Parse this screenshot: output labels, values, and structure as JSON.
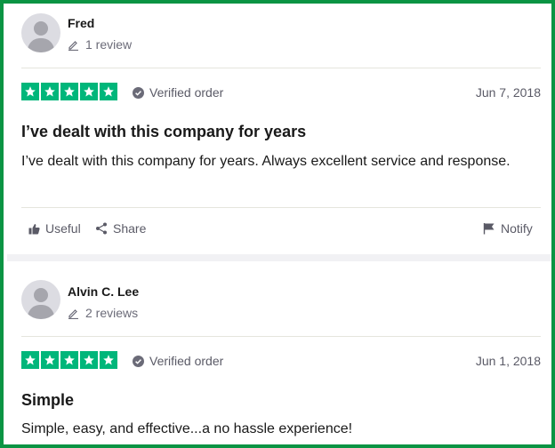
{
  "reviews": [
    {
      "author": "Fred",
      "review_count": "1 review",
      "rating": 5,
      "verified_label": "Verified order",
      "date": "Jun 7, 2018",
      "title": "I’ve dealt with this company for years",
      "body": "I’ve dealt with this company for years. Always excellent service and response."
    },
    {
      "author": "Alvin C. Lee",
      "review_count": "2 reviews",
      "rating": 5,
      "verified_label": "Verified order",
      "date": "Jun 1, 2018",
      "title": "Simple",
      "body": "Simple, easy, and effective...a no hassle experience!"
    }
  ],
  "actions": {
    "useful": "Useful",
    "share": "Share",
    "notify": "Notify"
  },
  "colors": {
    "accent_border": "#0b9443",
    "star_green": "#00b67a"
  }
}
